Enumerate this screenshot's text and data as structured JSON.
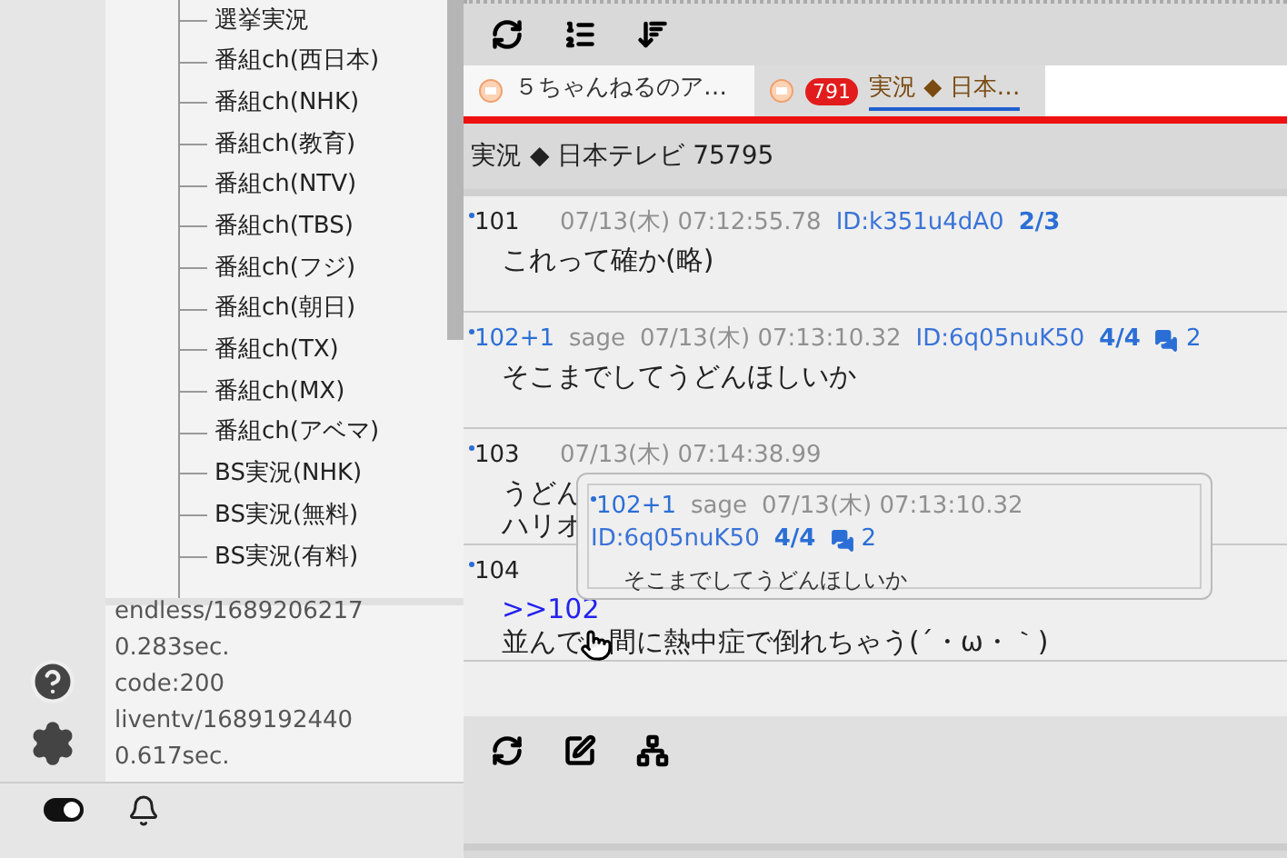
{
  "tree": {
    "items": [
      {
        "label": "選挙実況"
      },
      {
        "label": "番組ch(西日本)"
      },
      {
        "label": "番組ch(NHK)"
      },
      {
        "label": "番組ch(教育)"
      },
      {
        "label": "番組ch(NTV)"
      },
      {
        "label": "番組ch(TBS)"
      },
      {
        "label": "番組ch(フジ)"
      },
      {
        "label": "番組ch(朝日)"
      },
      {
        "label": "番組ch(TX)"
      },
      {
        "label": "番組ch(MX)"
      },
      {
        "label": "番組ch(アベマ)"
      },
      {
        "label": "BS実況(NHK)"
      },
      {
        "label": "BS実況(無料)"
      },
      {
        "label": "BS実況(有料)"
      }
    ]
  },
  "log": [
    "endless/1689206217",
    "0.283sec.",
    "code:200",
    "liventv/1689192440",
    "0.617sec."
  ],
  "toggle": {
    "on": true
  },
  "tabs": [
    {
      "label": "５ちゃんねるのア…",
      "selected": false
    },
    {
      "label": "実況 ◆ 日本…",
      "badge": "791",
      "selected": true
    }
  ],
  "thread_title": "実況 ◆ 日本テレビ 75795",
  "posts": [
    {
      "number": "101",
      "referenced": false,
      "date": "07/13(木) 07:12:55.78",
      "id": "ID:k351u4dA0",
      "count": "2/3",
      "body": [
        "これって確か(略)"
      ]
    },
    {
      "number": "102+1",
      "referenced": true,
      "mail": "sage",
      "date": "07/13(木) 07:13:10.32",
      "id": "ID:6q05nuK50",
      "count": "4/4",
      "replies": "2",
      "body": [
        "そこまでしてうどんほしいか"
      ]
    },
    {
      "number": "103",
      "referenced": false,
      "date": "07/13(木) 07:14:38.99",
      "body": [
        "うどん",
        "ハリオ"
      ]
    },
    {
      "number": "104",
      "referenced": false,
      "link": ">>102",
      "body": [
        "並んで",
        "間に熱中症で倒れちゃう(´・ω・｀)"
      ]
    }
  ],
  "popup": {
    "number": "102+1",
    "referenced": true,
    "mail": "sage",
    "date": "07/13(木) 07:13:10.32",
    "id": "ID:6q05nuK50",
    "count": "4/4",
    "replies": "2",
    "body": "そこまでしてうどんほしいか"
  }
}
